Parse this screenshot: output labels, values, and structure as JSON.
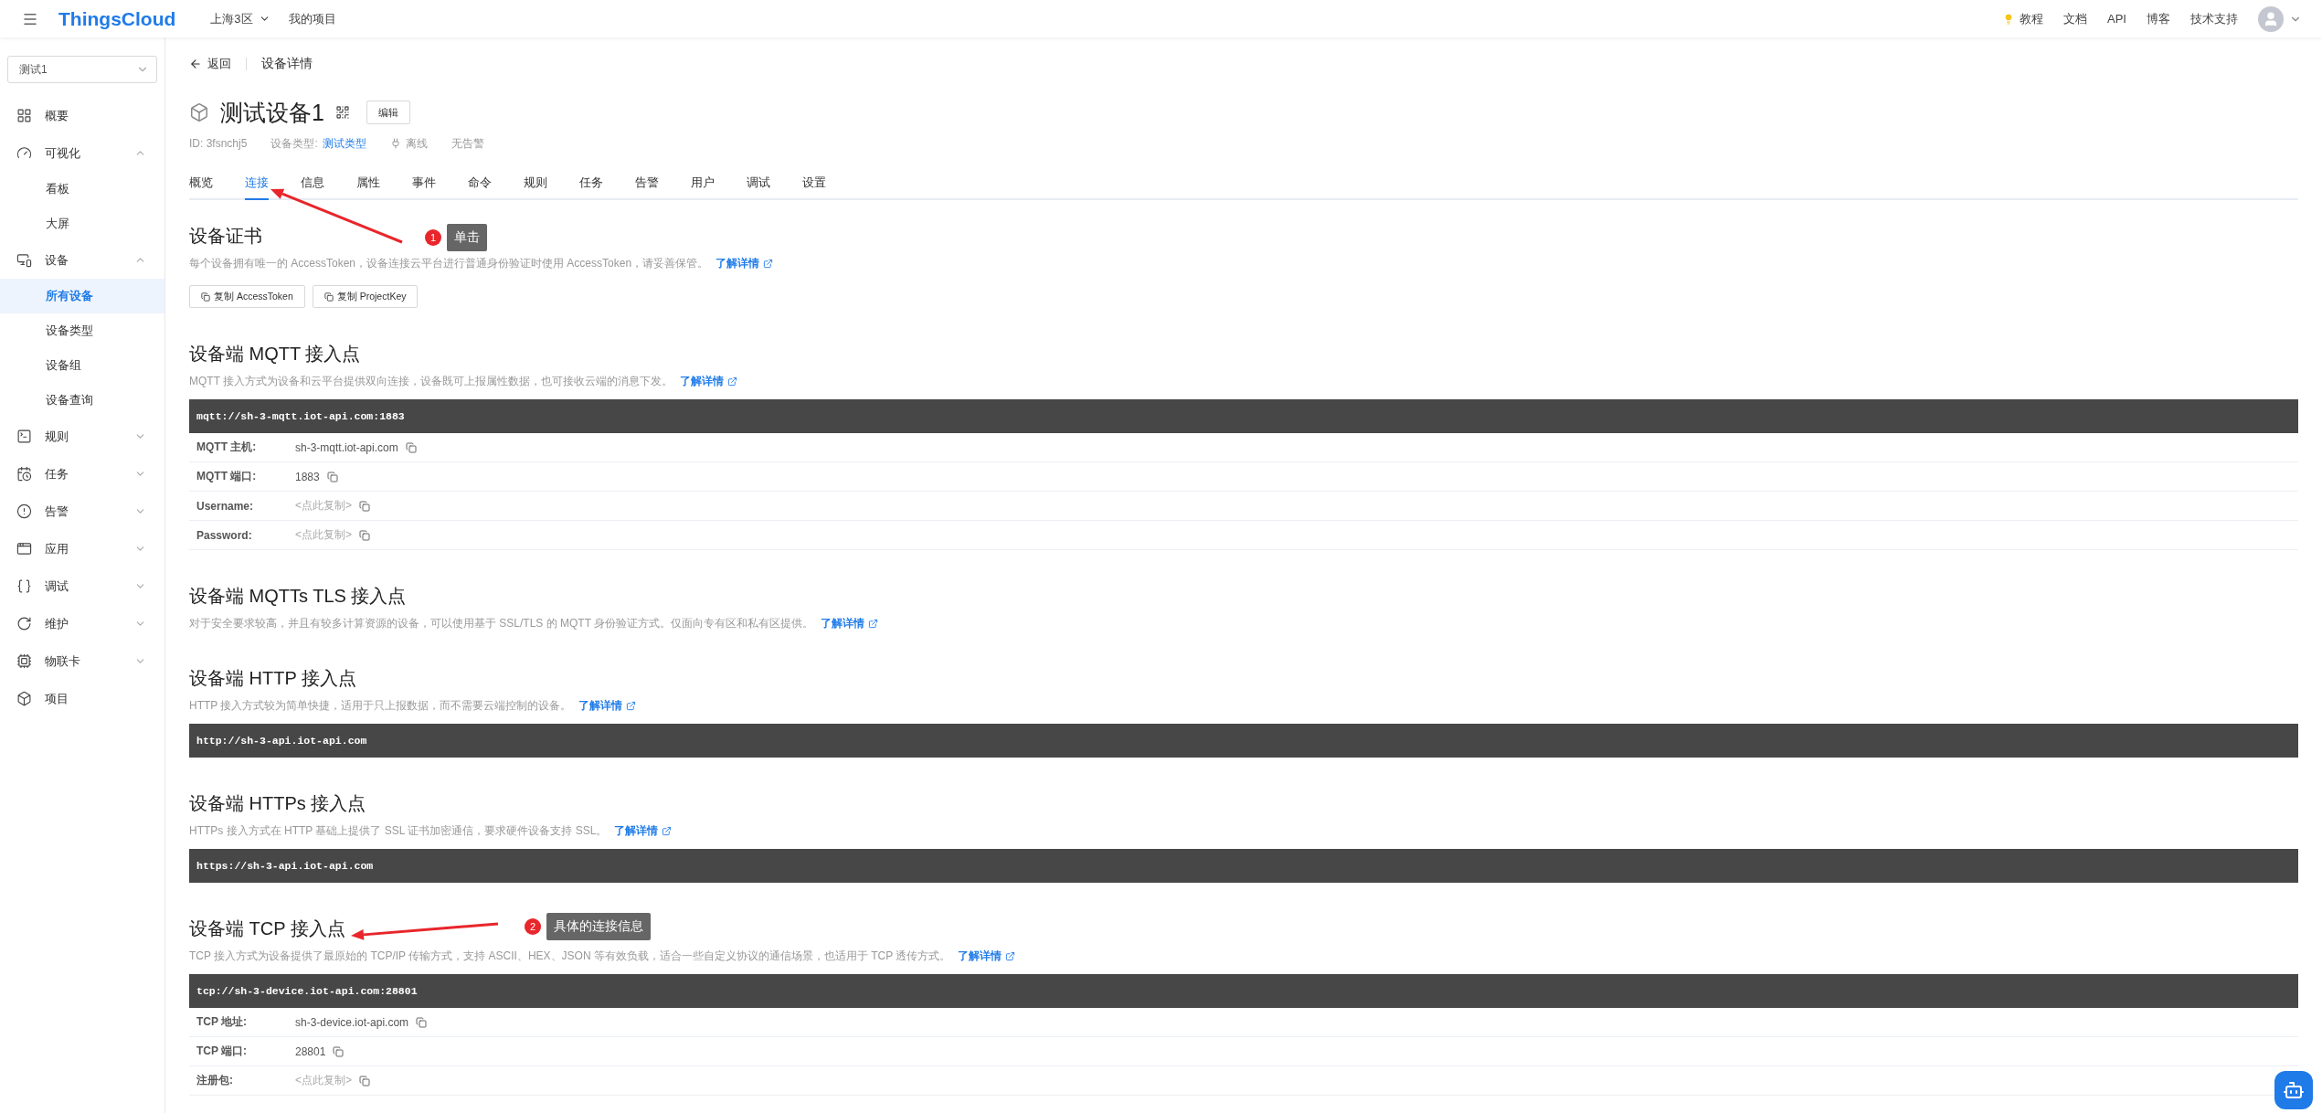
{
  "header": {
    "logo": "ThingsCloud",
    "region": "上海3区",
    "project_link": "我的项目",
    "links": [
      {
        "text": "教程",
        "kind": "tip"
      },
      {
        "text": "文档",
        "kind": "plain"
      },
      {
        "text": "API",
        "kind": "plain"
      },
      {
        "text": "博客",
        "kind": "plain"
      },
      {
        "text": "技术支持",
        "kind": "plain"
      }
    ]
  },
  "sidebar": {
    "project_select": "测试1",
    "items": [
      {
        "label": "概要",
        "kind": "link"
      },
      {
        "label": "可视化",
        "kind": "group",
        "expanded": true,
        "children": [
          {
            "label": "看板",
            "selected": false
          },
          {
            "label": "大屏",
            "selected": false
          }
        ]
      },
      {
        "label": "设备",
        "kind": "group",
        "expanded": true,
        "children": [
          {
            "label": "所有设备",
            "selected": true
          },
          {
            "label": "设备类型",
            "selected": false
          },
          {
            "label": "设备组",
            "selected": false
          },
          {
            "label": "设备查询",
            "selected": false
          }
        ]
      },
      {
        "label": "规则",
        "kind": "group",
        "expanded": false
      },
      {
        "label": "任务",
        "kind": "group",
        "expanded": false
      },
      {
        "label": "告警",
        "kind": "group",
        "expanded": false
      },
      {
        "label": "应用",
        "kind": "group",
        "expanded": false
      },
      {
        "label": "调试",
        "kind": "group",
        "expanded": false
      },
      {
        "label": "维护",
        "kind": "group",
        "expanded": false
      },
      {
        "label": "物联卡",
        "kind": "group",
        "expanded": false
      },
      {
        "label": "项目",
        "kind": "link"
      }
    ]
  },
  "breadcrumb": {
    "back": "返回",
    "title": "设备详情"
  },
  "device": {
    "name": "测试设备1",
    "edit_button": "编辑",
    "id": "ID: 3fsnchj5",
    "type_label": "设备类型:",
    "type_link": "测试类型",
    "status": "离线",
    "alarm": "无告警"
  },
  "tabs": [
    {
      "label": "概览",
      "selected": false
    },
    {
      "label": "连接",
      "selected": true
    },
    {
      "label": "信息",
      "selected": false
    },
    {
      "label": "属性",
      "selected": false
    },
    {
      "label": "事件",
      "selected": false
    },
    {
      "label": "命令",
      "selected": false
    },
    {
      "label": "规则",
      "selected": false
    },
    {
      "label": "任务",
      "selected": false
    },
    {
      "label": "告警",
      "selected": false
    },
    {
      "label": "用户",
      "selected": false
    },
    {
      "label": "调试",
      "selected": false
    },
    {
      "label": "设置",
      "selected": false
    }
  ],
  "sections": [
    {
      "title": "设备证书",
      "description": "每个设备拥有唯一的 AccessToken，设备连接云平台进行普通身份验证时使用 AccessToken，请妥善保管。",
      "link": "了解详情",
      "buttons": [
        "复制 AccessToken",
        "复制 ProjectKey"
      ]
    },
    {
      "title": "设备端 MQTT 接入点",
      "description": "MQTT 接入方式为设备和云平台提供双向连接，设备既可上报属性数据，也可接收云端的消息下发。",
      "link": "了解详情",
      "url": "mqtt://sh-3-mqtt.iot-api.com:1883",
      "fields": [
        {
          "label": "MQTT 主机:",
          "value": "sh-3-mqtt.iot-api.com",
          "muted": false
        },
        {
          "label": "MQTT 端口:",
          "value": "1883",
          "muted": false
        },
        {
          "label": "Username:",
          "value": "<点此复制>",
          "muted": true
        },
        {
          "label": "Password:",
          "value": "<点此复制>",
          "muted": true
        }
      ]
    },
    {
      "title": "设备端 MQTTs TLS 接入点",
      "description": "对于安全要求较高，并且有较多计算资源的设备，可以使用基于 SSL/TLS 的 MQTT 身份验证方式。仅面向专有区和私有区提供。",
      "link": "了解详情"
    },
    {
      "title": "设备端 HTTP 接入点",
      "description": "HTTP 接入方式较为简单快捷，适用于只上报数据，而不需要云端控制的设备。",
      "link": "了解详情",
      "url": "http://sh-3-api.iot-api.com"
    },
    {
      "title": "设备端 HTTPs 接入点",
      "description": "HTTPs 接入方式在 HTTP 基础上提供了 SSL 证书加密通信，要求硬件设备支持 SSL。",
      "link": "了解详情",
      "url": "https://sh-3-api.iot-api.com"
    },
    {
      "title": "设备端 TCP 接入点",
      "description": "TCP 接入方式为设备提供了最原始的 TCP/IP 传输方式，支持 ASCII、HEX、JSON 等有效负载，适合一些自定义协议的通信场景，也适用于 TCP 透传方式。",
      "link": "了解详情",
      "url": "tcp://sh-3-device.iot-api.com:28801",
      "fields": [
        {
          "label": "TCP 地址:",
          "value": "sh-3-device.iot-api.com",
          "muted": false
        },
        {
          "label": "TCP 端口:",
          "value": "28801",
          "muted": false
        },
        {
          "label": "注册包:",
          "value": "<点此复制>",
          "muted": true
        }
      ]
    }
  ],
  "annotations": [
    {
      "number": "1",
      "text": "单击"
    },
    {
      "number": "2",
      "text": "具体的连接信息"
    }
  ]
}
